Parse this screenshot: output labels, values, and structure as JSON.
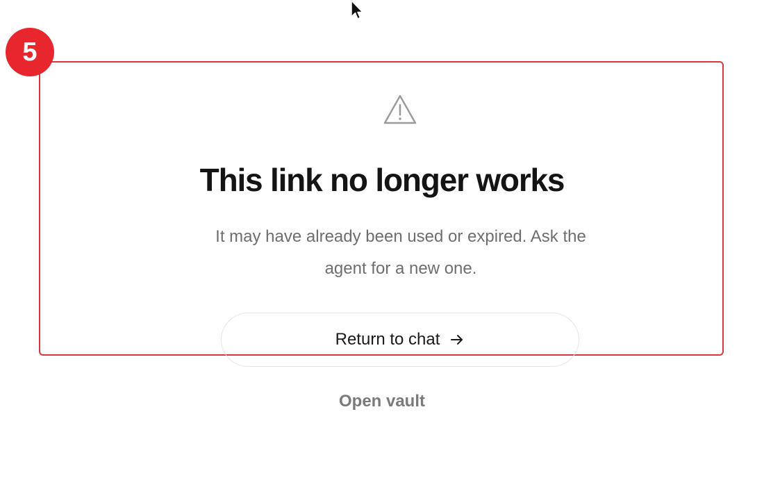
{
  "annotation": {
    "step_number": "5"
  },
  "error_card": {
    "icon": "warning-triangle-icon",
    "title": "This link no longer works",
    "description": "It may have already been used or expired. Ask the agent for a new one."
  },
  "actions": {
    "return_label": "Return to chat",
    "return_icon": "arrow-right-icon",
    "vault_label": "Open vault"
  },
  "colors": {
    "highlight": "#d9363e",
    "badge": "#e8262d",
    "title": "#141414",
    "muted_text": "#6e6e6e"
  }
}
